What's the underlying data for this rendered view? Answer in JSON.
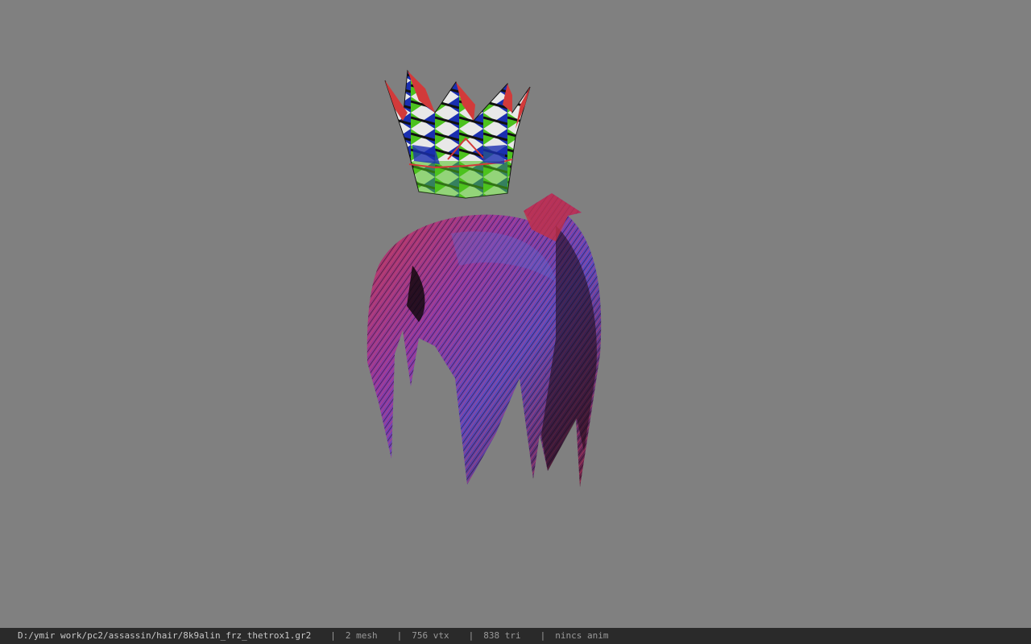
{
  "viewport": {
    "background": "#808080"
  },
  "models": [
    {
      "name": "crown",
      "colors": [
        "#d23a3a",
        "#4cc21e",
        "#1a2fb0",
        "#ffffff",
        "#111111"
      ]
    },
    {
      "name": "hair",
      "colors": [
        "#c2344a",
        "#7a3a9a",
        "#3a5ac8",
        "#1a0a12"
      ]
    }
  ],
  "statusbar": {
    "file_path": "D:/ymir work/pc2/assassin/hair/8k9alin_frz_thetrox1.gr2",
    "separator": "|",
    "mesh": "2 mesh",
    "vtx": "756 vtx",
    "tri": "838 tri",
    "anim": "nincs anim"
  }
}
